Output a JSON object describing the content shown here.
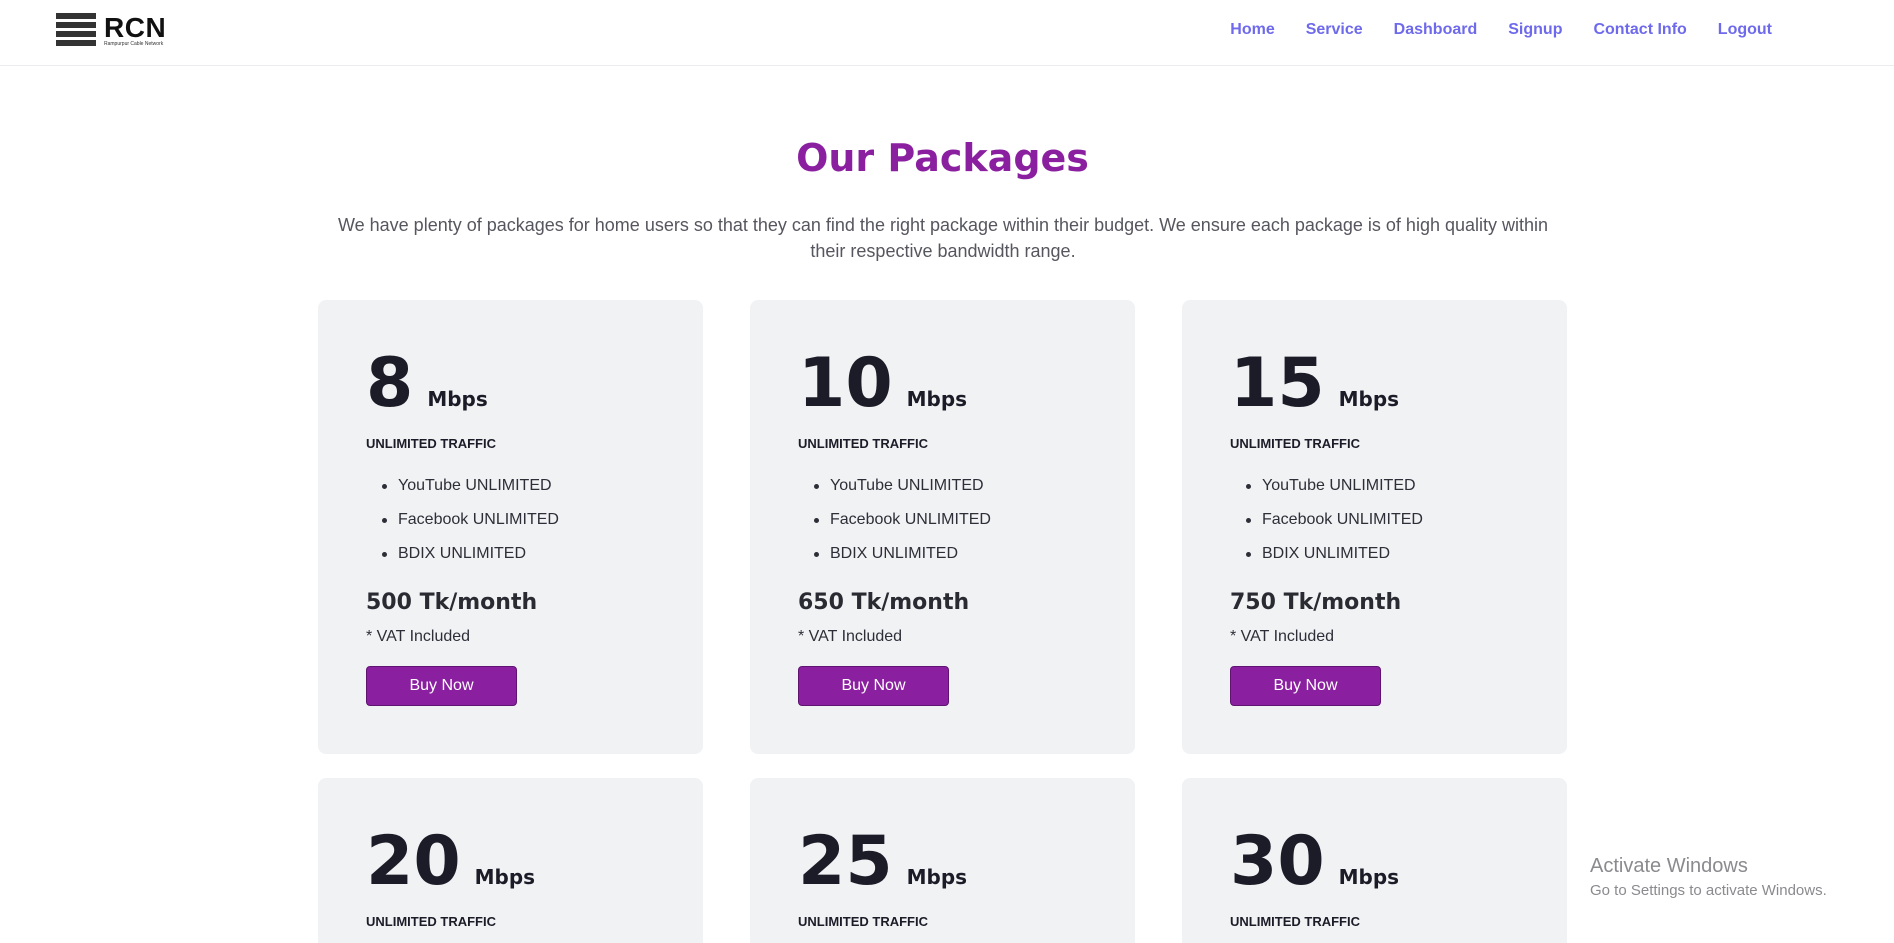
{
  "logo": {
    "text": "RCN",
    "subtext": "Rampurpur Cable Network"
  },
  "nav": [
    "Home",
    "Service",
    "Dashboard",
    "Signup",
    "Contact Info",
    "Logout"
  ],
  "section": {
    "title": "Our Packages",
    "description": "We have plenty of packages for home users so that they can find the right package within their budget. We ensure each package is of high quality within their respective bandwidth range."
  },
  "packages": [
    {
      "speed": "8",
      "unit": "Mbps",
      "traffic": "UNLIMITED TRAFFIC",
      "features": [
        "YouTube UNLIMITED",
        "Facebook UNLIMITED",
        "BDIX UNLIMITED"
      ],
      "price": "500 Tk/month",
      "vat": "* VAT Included",
      "button": "Buy Now"
    },
    {
      "speed": "10",
      "unit": "Mbps",
      "traffic": "UNLIMITED TRAFFIC",
      "features": [
        "YouTube UNLIMITED",
        "Facebook UNLIMITED",
        "BDIX UNLIMITED"
      ],
      "price": "650 Tk/month",
      "vat": "* VAT Included",
      "button": "Buy Now"
    },
    {
      "speed": "15",
      "unit": "Mbps",
      "traffic": "UNLIMITED TRAFFIC",
      "features": [
        "YouTube UNLIMITED",
        "Facebook UNLIMITED",
        "BDIX UNLIMITED"
      ],
      "price": "750 Tk/month",
      "vat": "* VAT Included",
      "button": "Buy Now"
    },
    {
      "speed": "20",
      "unit": "Mbps",
      "traffic": "UNLIMITED TRAFFIC"
    },
    {
      "speed": "25",
      "unit": "Mbps",
      "traffic": "UNLIMITED TRAFFIC"
    },
    {
      "speed": "30",
      "unit": "Mbps",
      "traffic": "UNLIMITED TRAFFIC"
    }
  ],
  "watermark": {
    "title": "Activate Windows",
    "subtitle": "Go to Settings to activate Windows."
  },
  "colors": {
    "accent": "#8a1fa0",
    "nav": "#6e6aeb",
    "card": "#f1f2f4"
  }
}
